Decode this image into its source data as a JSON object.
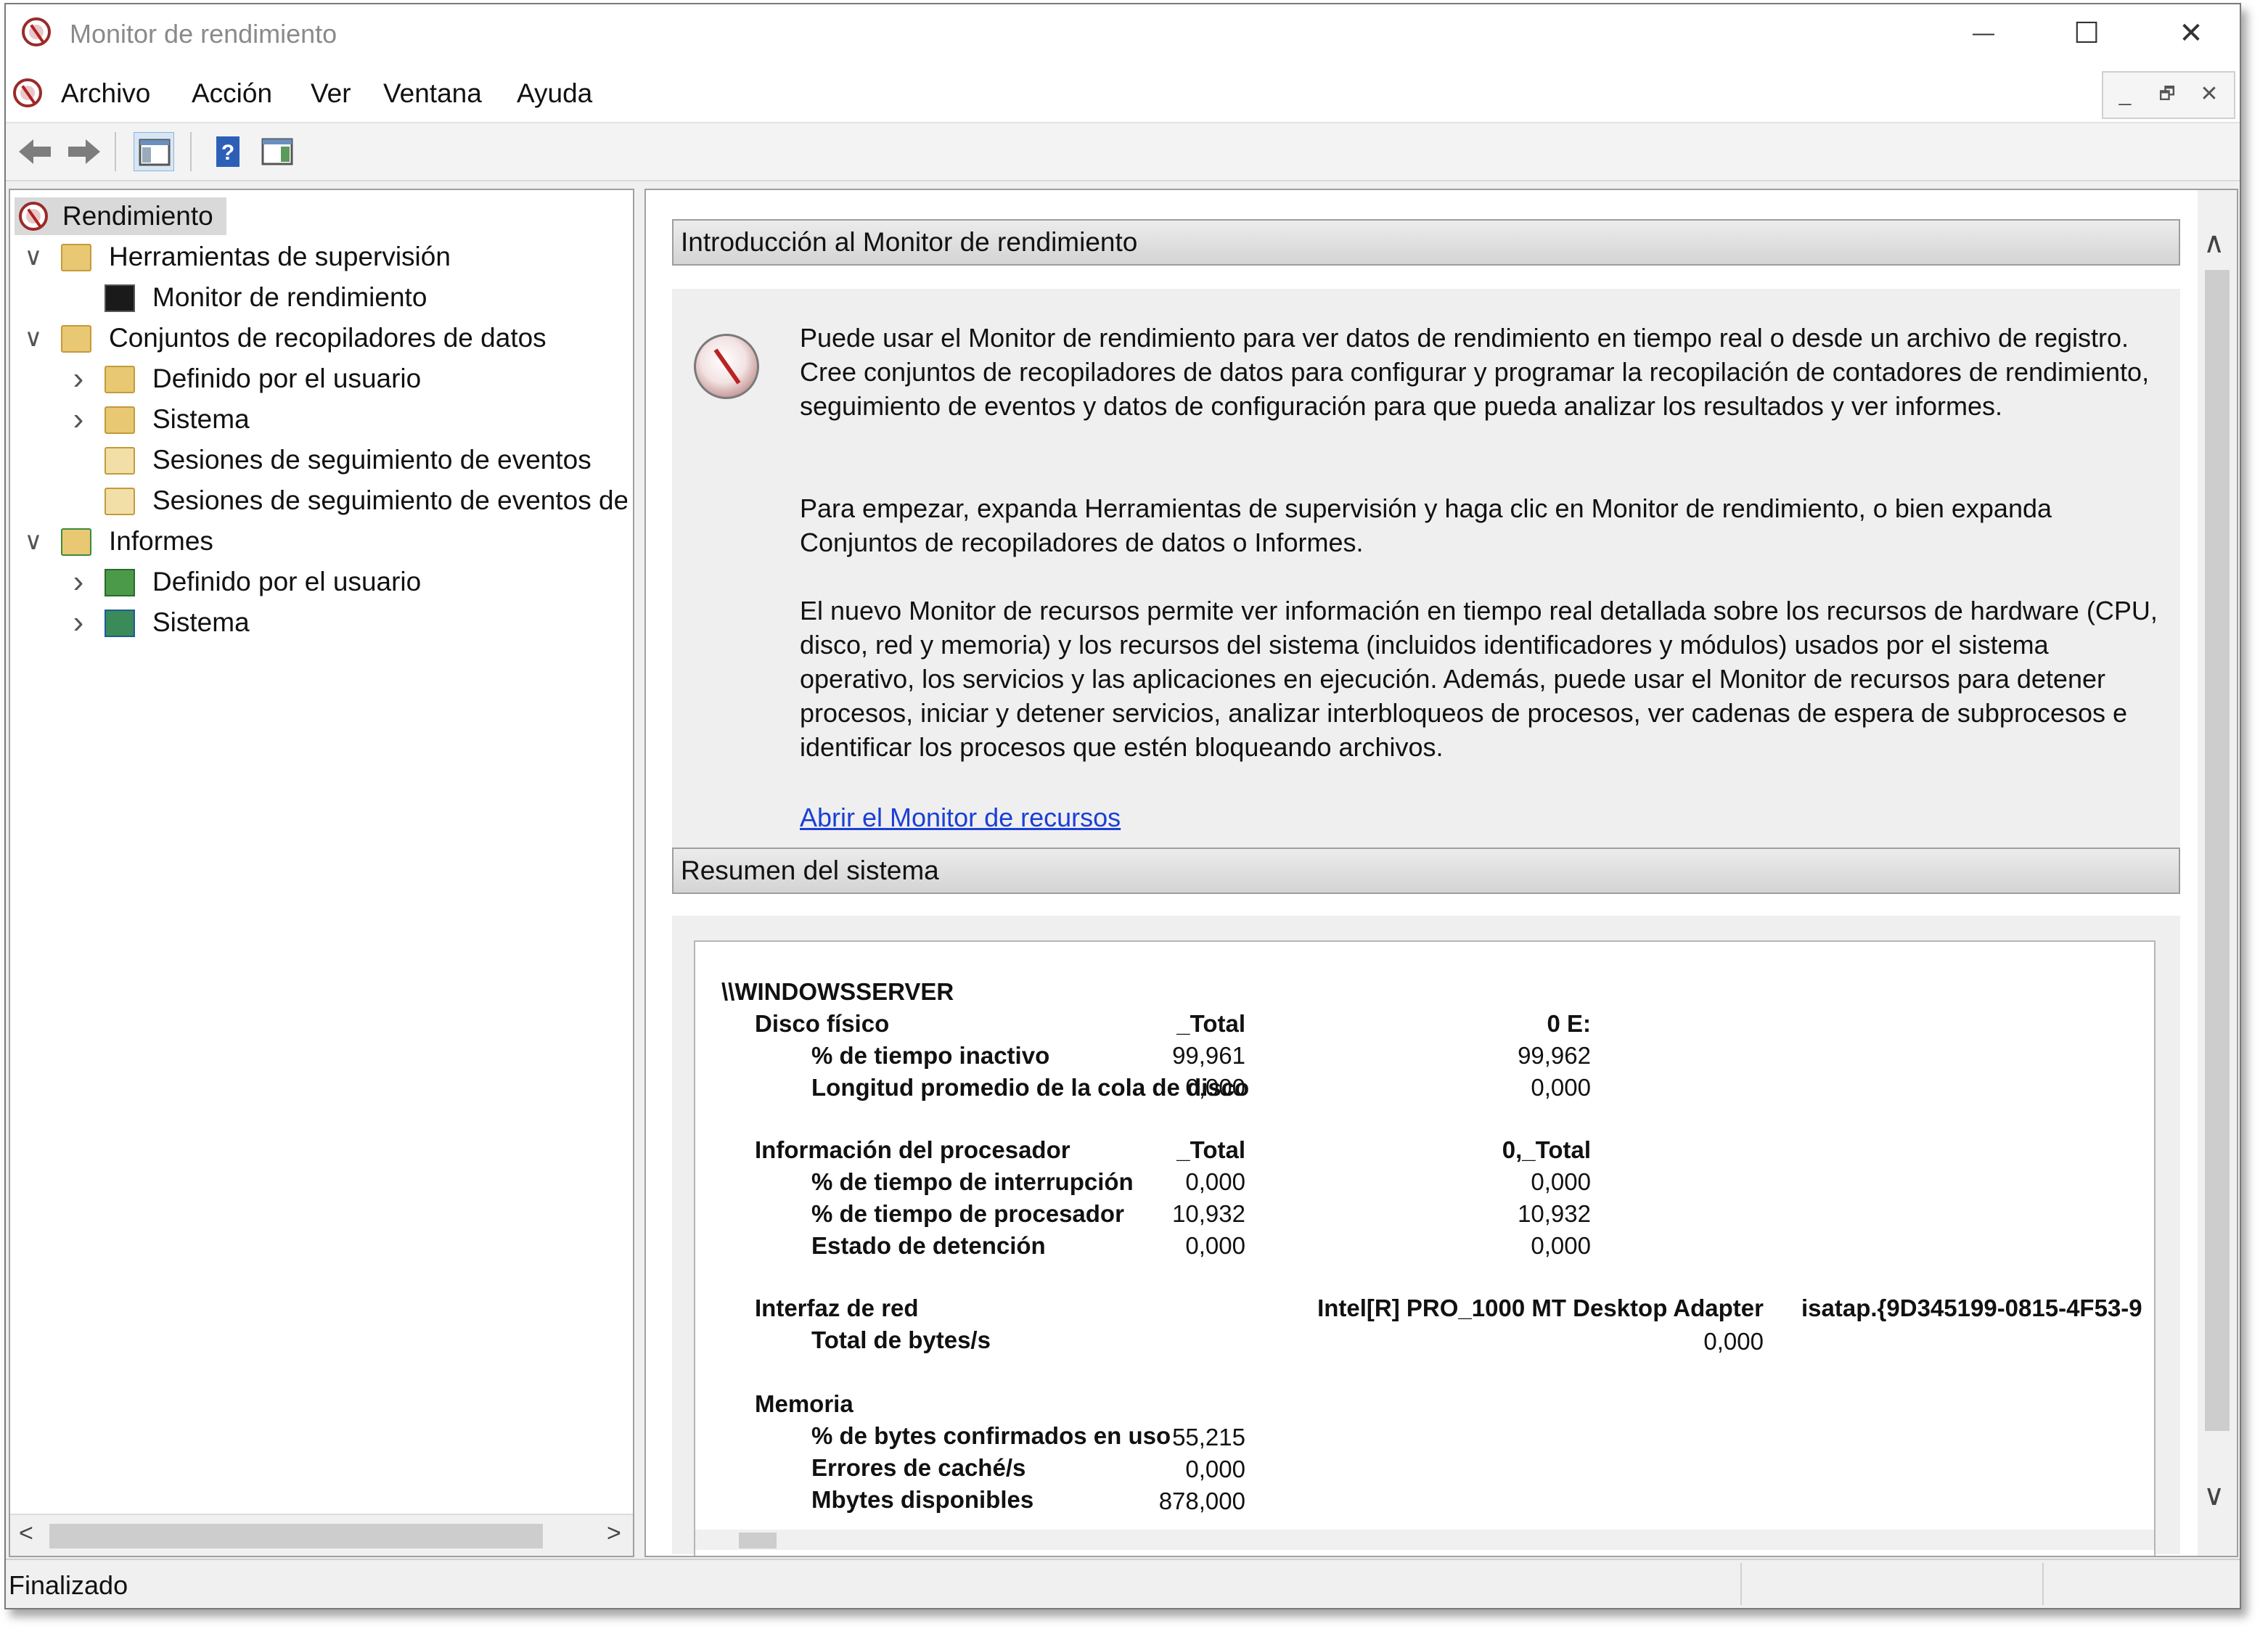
{
  "window": {
    "title": "Monitor de rendimiento",
    "controls": {
      "minimize": "—",
      "maximize": "☐",
      "close": "✕"
    }
  },
  "menu": {
    "items": [
      "Archivo",
      "Acción",
      "Ver",
      "Ventana",
      "Ayuda"
    ],
    "mdi_controls": {
      "minimize": "_",
      "restore": "🗗",
      "close": "✕"
    }
  },
  "toolbar": {
    "buttons": [
      "back-icon",
      "forward-icon",
      "show-hide-console-tree-icon",
      "help-icon",
      "show-hide-action-pane-icon"
    ]
  },
  "tree": {
    "root": "Rendimiento",
    "items": [
      {
        "label": "Herramientas de supervisión",
        "expander": "∨"
      },
      {
        "label": "Monitor de rendimiento"
      },
      {
        "label": "Conjuntos de recopiladores de datos",
        "expander": "∨"
      },
      {
        "label": "Definido por el usuario",
        "expander": "›"
      },
      {
        "label": "Sistema",
        "expander": "›"
      },
      {
        "label": "Sesiones de seguimiento de eventos"
      },
      {
        "label": "Sesiones de seguimiento de eventos de i"
      },
      {
        "label": "Informes",
        "expander": "∨"
      },
      {
        "label": "Definido por el usuario",
        "expander": "›"
      },
      {
        "label": "Sistema",
        "expander": "›"
      }
    ],
    "scroll_left": "<",
    "scroll_right": ">"
  },
  "intro": {
    "heading": "Introducción al Monitor de rendimiento",
    "paragraphs": [
      "Puede usar el Monitor de rendimiento para ver datos de rendimiento en tiempo real o desde un archivo de registro. Cree conjuntos de recopiladores de datos para configurar y programar la recopilación de contadores de rendimiento, seguimiento de eventos y datos de configuración para que pueda analizar los resultados y ver informes.",
      "Para empezar, expanda Herramientas de supervisión y haga clic en Monitor de rendimiento, o bien expanda Conjuntos de recopiladores de datos o Informes.",
      "El nuevo Monitor de recursos permite ver información en tiempo real detallada sobre los recursos de hardware (CPU, disco, red y memoria) y los recursos del sistema (incluidos identificadores y módulos) usados por el sistema operativo, los servicios y las aplicaciones en ejecución. Además, puede usar el Monitor de recursos para detener procesos, iniciar y detener servicios, analizar interbloqueos de procesos, ver cadenas de espera de subprocesos e identificar los procesos que estén bloqueando archivos."
    ],
    "link": "Abrir el Monitor de recursos"
  },
  "summary": {
    "heading": "Resumen del sistema",
    "server": "\\\\WINDOWSSERVER",
    "disk": {
      "label": "Disco físico",
      "col1": "_Total",
      "col2": "0 E:",
      "rows": [
        {
          "label": "% de tiempo inactivo",
          "v1": "99,961",
          "v2": "99,962"
        },
        {
          "label": "Longitud promedio de la cola de disco",
          "v1": "0,000",
          "v2": "0,000"
        }
      ]
    },
    "cpu": {
      "label": "Información del procesador",
      "col1": "_Total",
      "col2": "0,_Total",
      "rows": [
        {
          "label": "% de tiempo de interrupción",
          "v1": "0,000",
          "v2": "0,000"
        },
        {
          "label": "% de tiempo de procesador",
          "v1": "10,932",
          "v2": "10,932"
        },
        {
          "label": "Estado de detención",
          "v1": "0,000",
          "v2": "0,000"
        }
      ]
    },
    "net": {
      "label": "Interfaz de red",
      "col1": "Intel[R] PRO_1000 MT Desktop Adapter",
      "col2": "isatap.{9D345199-0815-4F53-9",
      "rows": [
        {
          "label": "Total de bytes/s",
          "v1": "0,000"
        }
      ]
    },
    "memory": {
      "label": "Memoria",
      "rows": [
        {
          "label": "% de bytes confirmados en uso",
          "v1": "55,215"
        },
        {
          "label": "Errores de caché/s",
          "v1": "0,000"
        },
        {
          "label": "Mbytes disponibles",
          "v1": "878,000"
        }
      ]
    }
  },
  "scrollbar": {
    "up": "∧",
    "down": "∨"
  },
  "status": {
    "text": "Finalizado"
  }
}
